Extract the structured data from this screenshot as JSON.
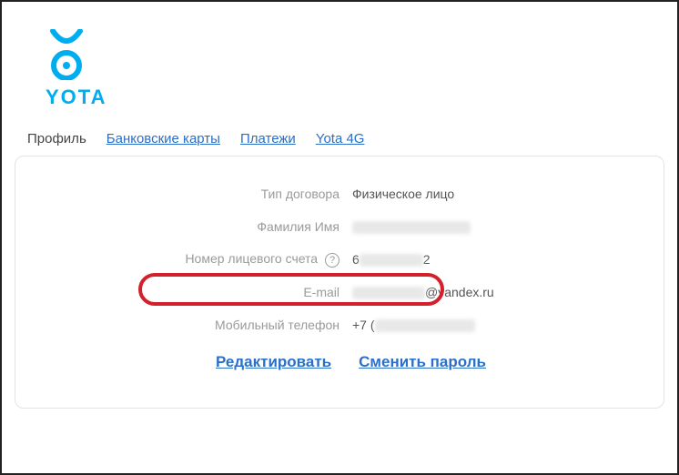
{
  "brand": {
    "name": "YOTA",
    "color": "#00aeef"
  },
  "tabs": [
    {
      "label": "Профиль",
      "active": true
    },
    {
      "label": "Банковские карты",
      "active": false
    },
    {
      "label": "Платежи",
      "active": false
    },
    {
      "label": "Yota 4G",
      "active": false
    }
  ],
  "profile": {
    "rows": {
      "contract_type": {
        "label": "Тип договора",
        "value": "Физическое лицо"
      },
      "full_name": {
        "label": "Фамилия Имя",
        "value_hidden": true
      },
      "account_number": {
        "label": "Номер лицевого счета",
        "value_prefix": "6",
        "value_suffix": "2",
        "value_hidden_mid": true,
        "has_help": true
      },
      "email": {
        "label": "E-mail",
        "value_suffix": "@yandex.ru",
        "value_hidden_prefix": true
      },
      "phone": {
        "label": "Мобильный телефон",
        "value_prefix": "+7 (",
        "value_hidden_suffix": true
      }
    }
  },
  "actions": {
    "edit": "Редактировать",
    "change_password": "Сменить пароль"
  },
  "help_glyph": "?"
}
